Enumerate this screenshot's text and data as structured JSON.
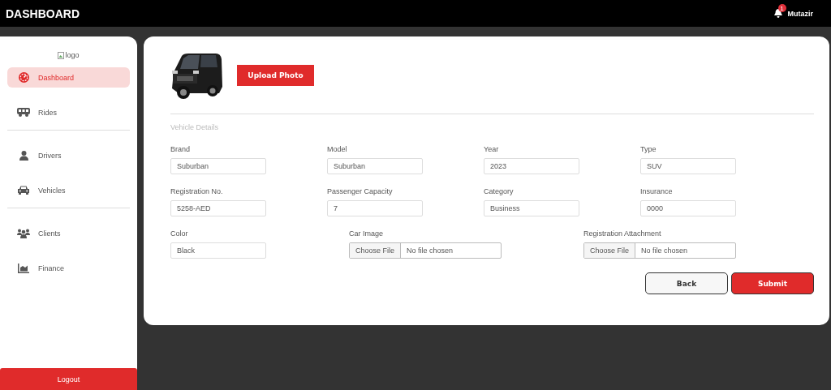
{
  "header": {
    "title": "DASHBOARD",
    "notifications": "1",
    "user": "Mutazir"
  },
  "sidebar": {
    "logo_alt": "logo",
    "groups": [
      {
        "items": [
          {
            "label": "Dashboard",
            "kind": "gauge",
            "selected": true
          },
          {
            "label": "Rides",
            "kind": "bus",
            "selected": false
          }
        ]
      },
      {
        "items": [
          {
            "label": "Drivers",
            "kind": "person",
            "selected": false
          },
          {
            "label": "Vehicles",
            "kind": "car",
            "selected": false
          }
        ]
      },
      {
        "items": [
          {
            "label": "Clients",
            "kind": "users",
            "selected": false
          },
          {
            "label": "Finance",
            "kind": "chart",
            "selected": false
          }
        ]
      }
    ],
    "logout": "Logout"
  },
  "form": {
    "upload_button": "Upload Photo",
    "section_title": "Vehicle Details",
    "rows": [
      {
        "fields": [
          {
            "kind": "text",
            "label": "Brand",
            "value": "Suburban"
          },
          {
            "kind": "text",
            "label": "Model",
            "value": "Suburban"
          },
          {
            "kind": "text",
            "label": "Year",
            "value": "2023"
          },
          {
            "kind": "text",
            "label": "Type",
            "value": "SUV"
          }
        ]
      },
      {
        "fields": [
          {
            "kind": "text",
            "label": "Registration No.",
            "value": "5258-AED"
          },
          {
            "kind": "text",
            "label": "Passenger Capacity",
            "value": "7"
          },
          {
            "kind": "text",
            "label": "Category",
            "value": "Business"
          },
          {
            "kind": "text",
            "label": "Insurance",
            "value": "0000"
          }
        ]
      },
      {
        "fields": [
          {
            "kind": "text",
            "label": "Color",
            "value": "Black"
          },
          {
            "kind": "file",
            "label": "Car Image",
            "button": "Choose File",
            "status": "No file chosen"
          },
          {
            "kind": "file",
            "label": "Registration Attachment",
            "button": "Choose File",
            "status": "No file chosen"
          }
        ]
      }
    ],
    "back_button": "Back",
    "submit_button": "Submit"
  }
}
